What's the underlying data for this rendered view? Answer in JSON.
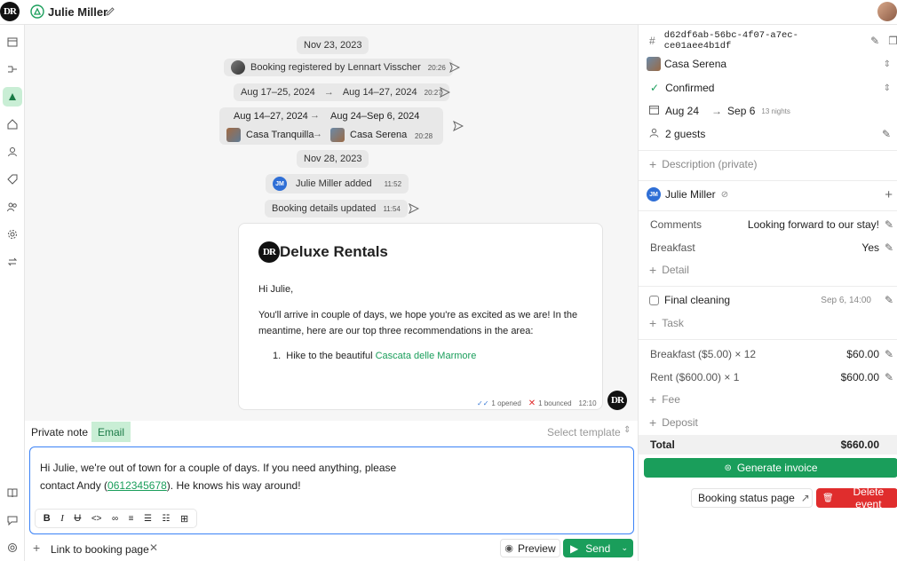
{
  "header": {
    "logo_text": "DR",
    "user_name": "Julie Miller"
  },
  "timeline": {
    "date1": "Nov 23, 2023",
    "registered": "Booking registered by Lennart Visscher",
    "registered_time": "20:26",
    "change1_from": "Aug 17–25, 2024",
    "change1_to": "Aug 14–27, 2024",
    "change1_time": "20:27",
    "change2_from_dates": "Aug 14–27, 2024",
    "change2_to_dates": "Aug 24–Sep 6, 2024",
    "change2_from_place": "Casa Tranquilla",
    "change2_to_place": "Casa Serena",
    "change2_time": "20:28",
    "date2": "Nov 28, 2023",
    "added_initials": "JM",
    "added": "Julie Miller added",
    "added_time": "11:52",
    "updated": "Booking details updated",
    "updated_time": "11:54"
  },
  "email": {
    "brand": "Deluxe Rentals",
    "greeting": "Hi Julie,",
    "body_line1": "You'll arrive in couple of days, we hope you're as excited as we are! In the",
    "body_line2": "meantime, here are our top three recommendations in the area:",
    "list_prefix": "Hike to the beautiful ",
    "list_link": "Cascata delle Marmore",
    "opened": "1 opened",
    "bounced": "1 bounced",
    "time": "12:10"
  },
  "composer": {
    "tab_private": "Private note",
    "tab_email": "Email",
    "select_template": "Select template",
    "text_line1": "Hi Julie, we're out of town for a couple of days. If you need anything, please",
    "text_line2_pre": "contact Andy (",
    "phone": "0612345678",
    "text_line2_post": "). He knows his way around!",
    "attachment": "Link to booking page",
    "preview": "Preview",
    "send": "Send"
  },
  "details": {
    "id": "d62df6ab-56bc-4f07-a7ec-ce01aee4b1df",
    "property": "Casa Serena",
    "status": "Confirmed",
    "start": "Aug 24",
    "end": "Sep 6",
    "nights": "13 nights",
    "guests": "2 guests",
    "description_placeholder": "Description (private)",
    "guest_name": "Julie Miller",
    "guest_initials": "JM",
    "comments_label": "Comments",
    "comments_value": "Looking forward to our stay!",
    "breakfast_label": "Breakfast",
    "breakfast_value": "Yes",
    "add_detail": "Detail",
    "task_name": "Final cleaning",
    "task_time": "Sep 6, 14:00",
    "add_task": "Task",
    "line1_label": "Breakfast ($5.00) × 12",
    "line1_value": "$60.00",
    "line2_label": "Rent ($600.00) × 1",
    "line2_value": "$600.00",
    "add_fee": "Fee",
    "add_deposit": "Deposit",
    "total_label": "Total",
    "total_value": "$660.00",
    "generate_invoice": "Generate invoice",
    "status_page": "Booking status page",
    "delete_event": "Delete event"
  },
  "colors": {
    "accent": "#1a9e5b",
    "link": "#1a9e5b",
    "danger": "#e02d2d",
    "email_tab_bg": "#c9eed5",
    "focus": "#3b82f6"
  }
}
